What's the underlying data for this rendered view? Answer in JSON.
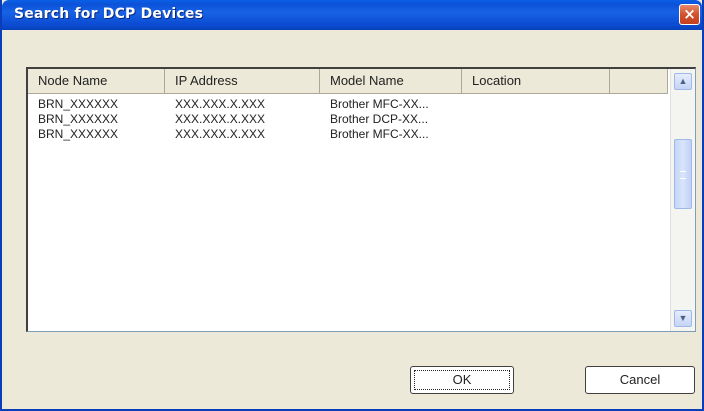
{
  "window": {
    "title": "Search for DCP Devices",
    "close_icon": "×"
  },
  "list": {
    "columns": [
      "Node Name",
      "IP Address",
      "Model Name",
      "Location"
    ],
    "rows": [
      [
        "BRN_XXXXXX",
        "XXX.XXX.X.XXX",
        "Brother MFC-XX...",
        ""
      ],
      [
        "BRN_XXXXXX",
        "XXX.XXX.X.XXX",
        "Brother DCP-XX...",
        ""
      ],
      [
        "BRN_XXXXXX",
        "XXX.XXX.X.XXX",
        "Brother MFC-XX...",
        ""
      ]
    ],
    "scroll_up_icon": "▲",
    "scroll_down_icon": "▼"
  },
  "buttons": {
    "ok": "OK",
    "cancel": "Cancel"
  }
}
